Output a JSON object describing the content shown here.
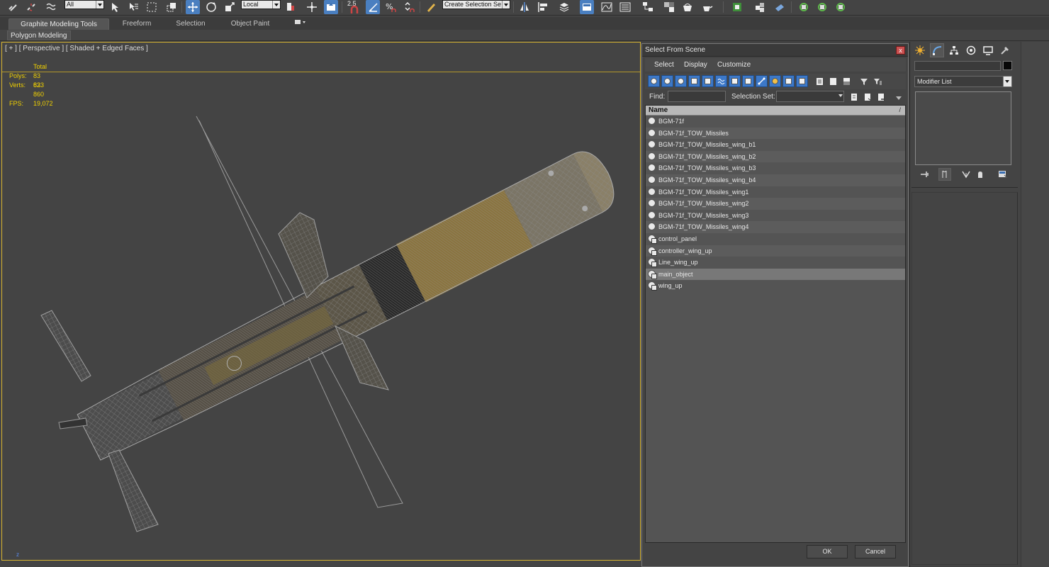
{
  "toolbar": {
    "selection_filter": "All",
    "ref_coord_system": "Local",
    "snap_value": "2.5",
    "named_selection_sets": "Create Selection Se",
    "icons": [
      "link-icon",
      "unlink-icon",
      "bind-space-warp-icon",
      "select-object-icon",
      "select-by-name-icon",
      "rect-region-icon",
      "window-crossing-icon",
      "move-icon",
      "rotate-icon",
      "scale-icon",
      "mirror-icon",
      "align-icon",
      "layer-icon",
      "graphite-toggle-icon",
      "curve-editor-icon",
      "schematic-icon",
      "material-editor-icon",
      "render-setup-icon",
      "render-frame-icon",
      "render-icon"
    ]
  },
  "ribbon": {
    "tabs": [
      "Graphite Modeling Tools",
      "Freeform",
      "Selection",
      "Object Paint"
    ],
    "active_tab": "Graphite Modeling Tools",
    "panel": "Polygon Modeling"
  },
  "viewport": {
    "label": "[ + ] [ Perspective ] [ Shaded + Edged Faces ]",
    "stats": {
      "header": "Total",
      "polys_label": "Polys:",
      "polys_value": "83 623",
      "verts_label": "Verts:",
      "verts_value": "83 860",
      "fps_label": "FPS:",
      "fps_value": "19,072"
    },
    "axis_label": "z",
    "colors": {
      "border": "#d7b431",
      "stats_text": "#f0d000",
      "wire": "#9a9a9a",
      "body_accent": "#b08e3a"
    }
  },
  "dialog": {
    "title": "Select From Scene",
    "close_label": "x",
    "menu": [
      "Select",
      "Display",
      "Customize"
    ],
    "find_label": "Find:",
    "find_value": "",
    "selection_set_label": "Selection Set:",
    "selection_set_value": "",
    "column_header": "Name",
    "rows": [
      {
        "name": "BGM-71f",
        "icon": "geometry",
        "selected": false
      },
      {
        "name": "BGM-71f_TOW_Missiles",
        "icon": "geometry",
        "selected": false
      },
      {
        "name": "BGM-71f_TOW_Missiles_wing_b1",
        "icon": "geometry",
        "selected": false
      },
      {
        "name": "BGM-71f_TOW_Missiles_wing_b2",
        "icon": "geometry",
        "selected": false
      },
      {
        "name": "BGM-71f_TOW_Missiles_wing_b3",
        "icon": "geometry",
        "selected": false
      },
      {
        "name": "BGM-71f_TOW_Missiles_wing_b4",
        "icon": "geometry",
        "selected": false
      },
      {
        "name": "BGM-71f_TOW_Missiles_wing1",
        "icon": "geometry",
        "selected": false
      },
      {
        "name": "BGM-71f_TOW_Missiles_wing2",
        "icon": "geometry",
        "selected": false
      },
      {
        "name": "BGM-71f_TOW_Missiles_wing3",
        "icon": "geometry",
        "selected": false
      },
      {
        "name": "BGM-71f_TOW_Missiles_wing4",
        "icon": "geometry",
        "selected": false
      },
      {
        "name": "control_panel",
        "icon": "group",
        "selected": false
      },
      {
        "name": "controller_wing_up",
        "icon": "group",
        "selected": false
      },
      {
        "name": "Line_wing_up",
        "icon": "group",
        "selected": false
      },
      {
        "name": "main_object",
        "icon": "group",
        "selected": true
      },
      {
        "name": "wing_up",
        "icon": "group",
        "selected": false
      }
    ],
    "ok_label": "OK",
    "cancel_label": "Cancel"
  },
  "command_panel": {
    "tabs": [
      "create-icon",
      "modify-icon",
      "hierarchy-icon",
      "motion-icon",
      "display-icon",
      "utilities-icon"
    ],
    "active_tab": "modify-icon",
    "object_name": "",
    "object_color": "#080808",
    "modifier_list": "Modifier List"
  }
}
